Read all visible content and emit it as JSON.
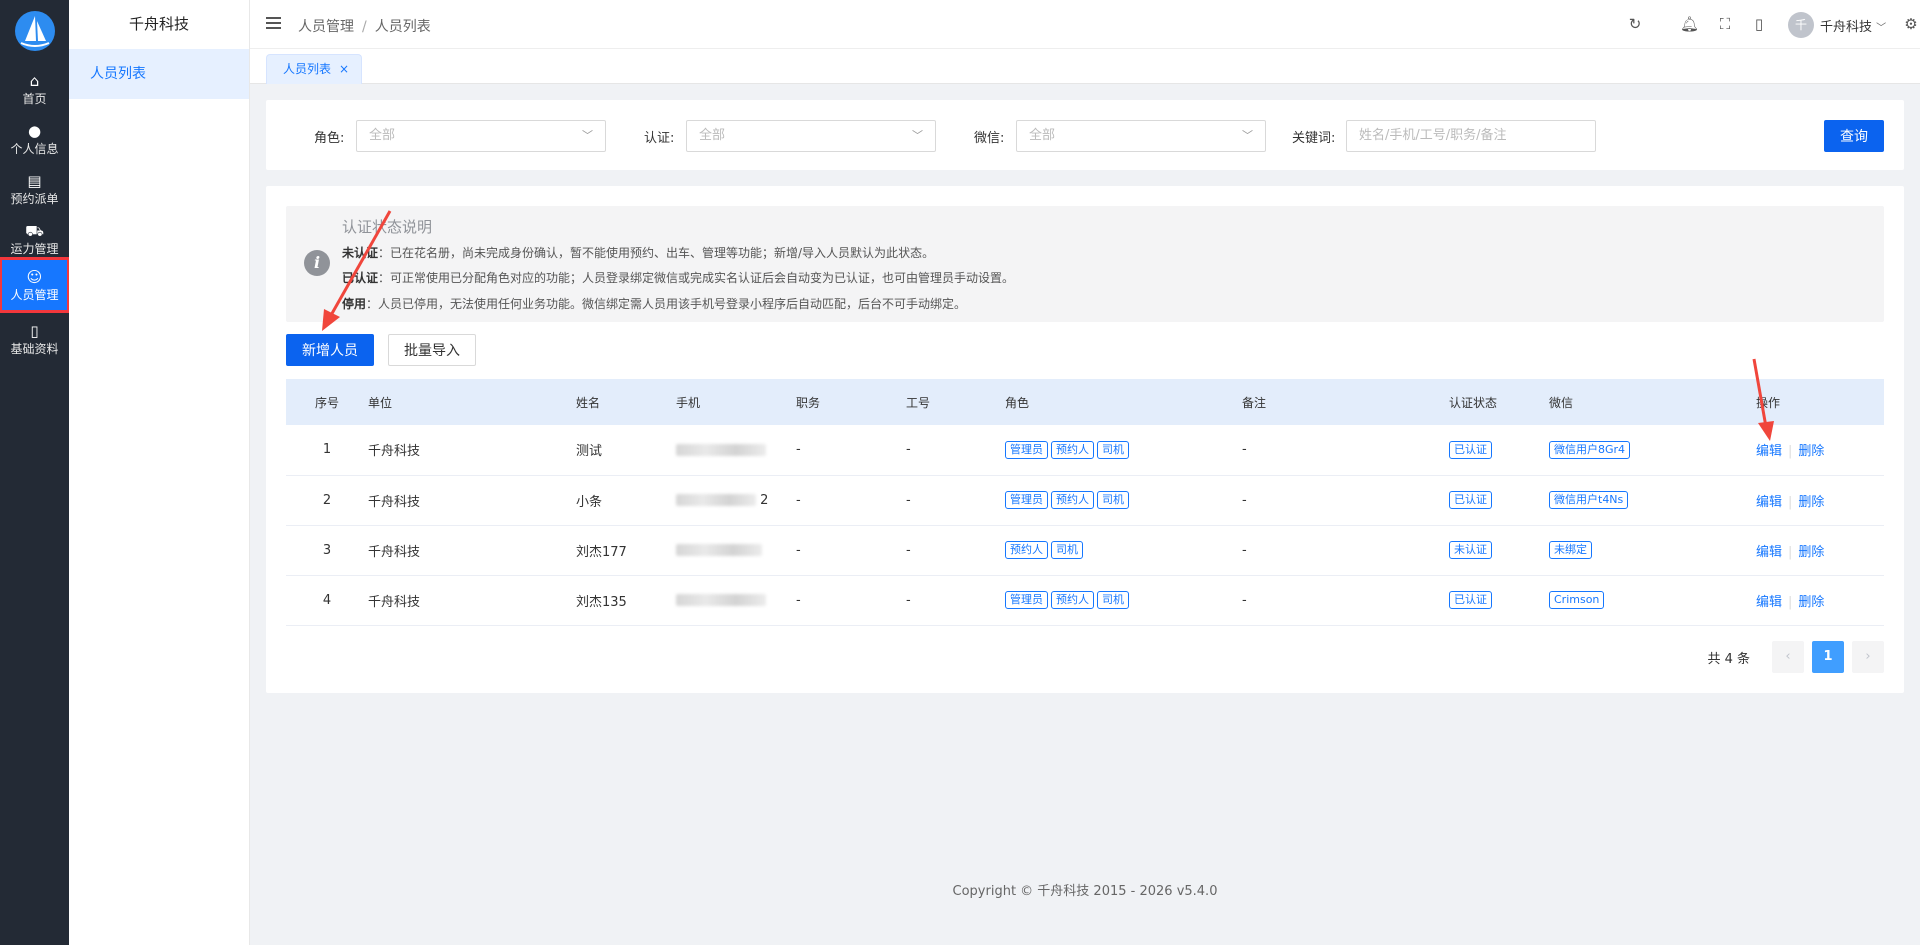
{
  "rail": {
    "items": [
      {
        "label": "首页",
        "icon": "home-icon"
      },
      {
        "label": "个人信息",
        "icon": "user-icon"
      },
      {
        "label": "预约派单",
        "icon": "document-icon"
      },
      {
        "label": "运力管理",
        "icon": "truck-icon"
      },
      {
        "label": "人员管理",
        "icon": "person-icon"
      },
      {
        "label": "基础资料",
        "icon": "book-icon"
      }
    ]
  },
  "submenu": {
    "brand": "千舟科技",
    "item": "人员列表"
  },
  "header": {
    "breadcrumb": [
      "人员管理",
      "人员列表"
    ],
    "avatar_letter": "千",
    "user_name": "千舟科技"
  },
  "tab": {
    "label": "人员列表",
    "close": "×"
  },
  "filter": {
    "role_label": "角色:",
    "role_value": "全部",
    "auth_label": "认证:",
    "auth_value": "全部",
    "wechat_label": "微信:",
    "wechat_value": "全部",
    "keyword_label": "关键词:",
    "keyword_placeholder": "姓名/手机/工号/职务/备注",
    "query_button": "查询"
  },
  "notice": {
    "title": "认证状态说明",
    "lines": [
      {
        "key": "未认证",
        "text": "：已在花名册，尚未完成身份确认，暂不能使用预约、出车、管理等功能；新增/导入人员默认为此状态。"
      },
      {
        "key": "已认证",
        "text": "：可正常使用已分配角色对应的功能；人员登录绑定微信或完成实名认证后会自动变为已认证，也可由管理员手动设置。"
      },
      {
        "key": "停用",
        "text": "：人员已停用，无法使用任何业务功能。微信绑定需人员用该手机号登录小程序后自动匹配，后台不可手动绑定。"
      }
    ]
  },
  "actions": {
    "add": "新增人员",
    "import": "批量导入"
  },
  "table": {
    "headers": [
      "序号",
      "单位",
      "姓名",
      "手机",
      "职务",
      "工号",
      "角色",
      "备注",
      "认证状态",
      "微信",
      "操作"
    ],
    "edit_label": "编辑",
    "delete_label": "删除",
    "rows": [
      {
        "idx": "1",
        "unit": "千舟科技",
        "name": "测试",
        "phone_tail": "",
        "job": "-",
        "no": "-",
        "roles": [
          "管理员",
          "预约人",
          "司机"
        ],
        "remark": "-",
        "auth": "已认证",
        "wechat": "微信用户8Gr4"
      },
      {
        "idx": "2",
        "unit": "千舟科技",
        "name": "小条",
        "phone_tail": "2",
        "job": "-",
        "no": "-",
        "roles": [
          "管理员",
          "预约人",
          "司机"
        ],
        "remark": "-",
        "auth": "已认证",
        "wechat": "微信用户t4Ns"
      },
      {
        "idx": "3",
        "unit": "千舟科技",
        "name": "刘杰177",
        "phone_tail": "",
        "job": "-",
        "no": "-",
        "roles": [
          "预约人",
          "司机"
        ],
        "remark": "-",
        "auth": "未认证",
        "wechat": "未绑定"
      },
      {
        "idx": "4",
        "unit": "千舟科技",
        "name": "刘杰135",
        "phone_tail": "",
        "job": "-",
        "no": "-",
        "roles": [
          "管理员",
          "预约人",
          "司机"
        ],
        "remark": "-",
        "auth": "已认证",
        "wechat": "Crimson"
      }
    ]
  },
  "pager": {
    "total": "共 4 条",
    "current": "1",
    "prev": "‹",
    "next": "›"
  },
  "footer": "Copyright © 千舟科技 2015 - 2026 v5.4.0",
  "colors": {
    "primary": "#0b63ef",
    "rail_bg": "#232a35",
    "highlight_outline": "#f2373c"
  }
}
